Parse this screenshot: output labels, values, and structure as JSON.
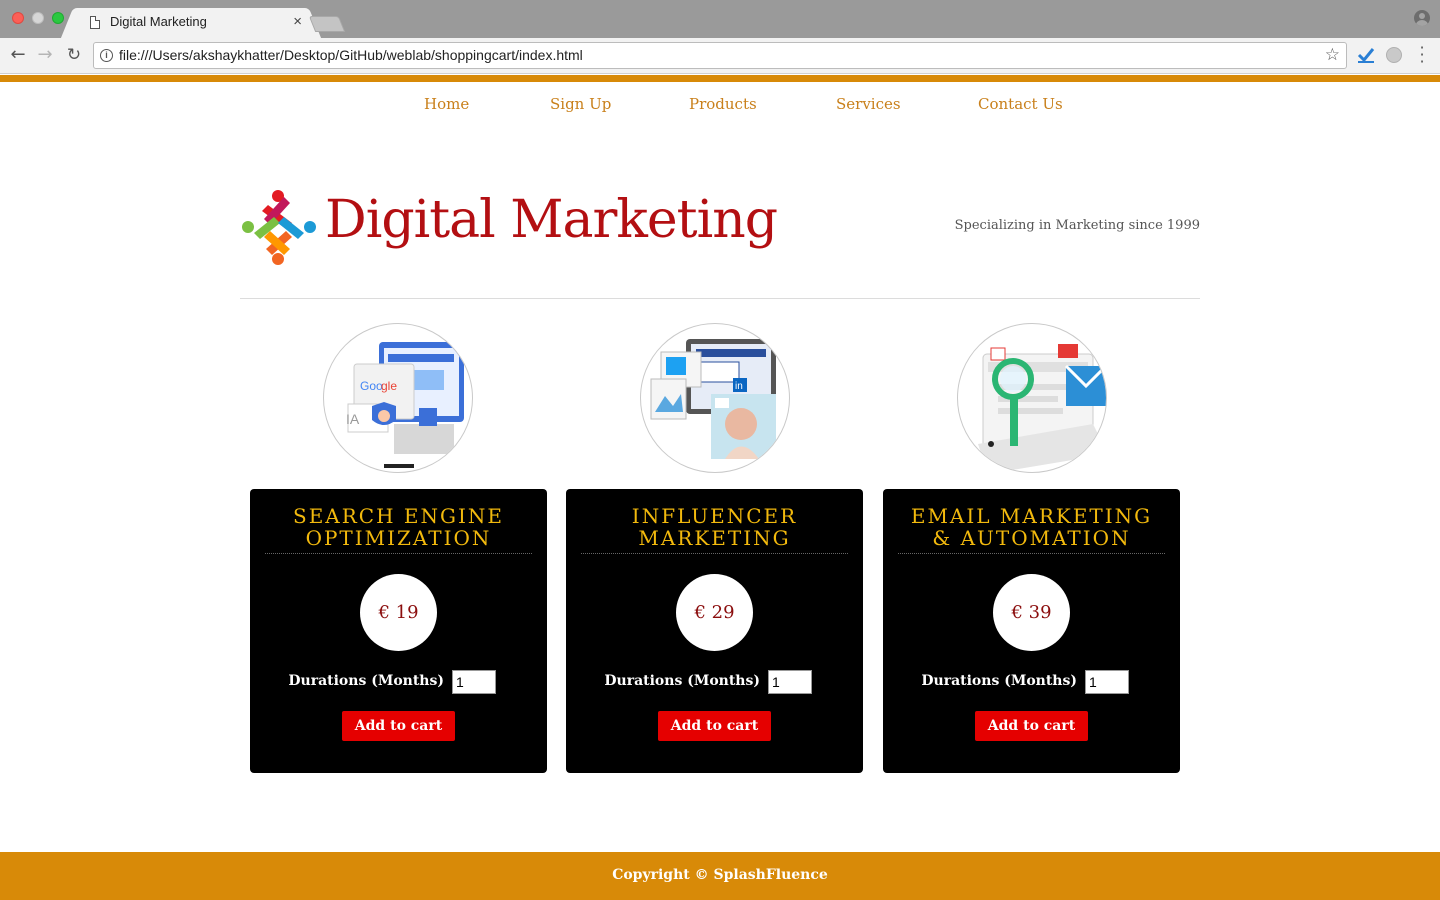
{
  "browser": {
    "tab_title": "Digital Marketing",
    "tab_close": "×",
    "url": "file:///Users/akshaykhatter/Desktop/GitHub/weblab/shoppingcart/index.html",
    "icons": [
      "page-icon",
      "back-icon",
      "forward-icon",
      "reload-icon",
      "info-icon",
      "star-icon",
      "extension-check-icon",
      "extension-globe-icon",
      "menu-icon",
      "profile-icon"
    ]
  },
  "nav": {
    "items": [
      {
        "label": "Home"
      },
      {
        "label": "Sign Up"
      },
      {
        "label": "Products"
      },
      {
        "label": "Services"
      },
      {
        "label": "Contact Us"
      }
    ]
  },
  "header": {
    "brand": "Digital Marketing",
    "tagline": "Specializing in Marketing since 1999"
  },
  "products": [
    {
      "title": "SEARCH ENGINE\nOPTIMIZATION",
      "price": "€ 19",
      "duration_label": "Durations (Months)",
      "duration_value": "1",
      "button": "Add to cart",
      "image": "seo-illustration"
    },
    {
      "title": "INFLUENCER\nMARKETING",
      "price": "€ 29",
      "duration_label": "Durations (Months)",
      "duration_value": "1",
      "button": "Add to cart",
      "image": "influencer-illustration"
    },
    {
      "title": "EMAIL MARKETING\n& AUTOMATION",
      "price": "€ 39",
      "duration_label": "Durations (Months)",
      "duration_value": "1",
      "button": "Add to cart",
      "image": "email-illustration"
    }
  ],
  "footer": {
    "text": "Copyright © SplashFluence"
  },
  "colors": {
    "accent": "#d88a08",
    "nav_link": "#c9801b",
    "brand": "#b30f12",
    "card_title": "#f2b90d",
    "button": "#e50000"
  }
}
